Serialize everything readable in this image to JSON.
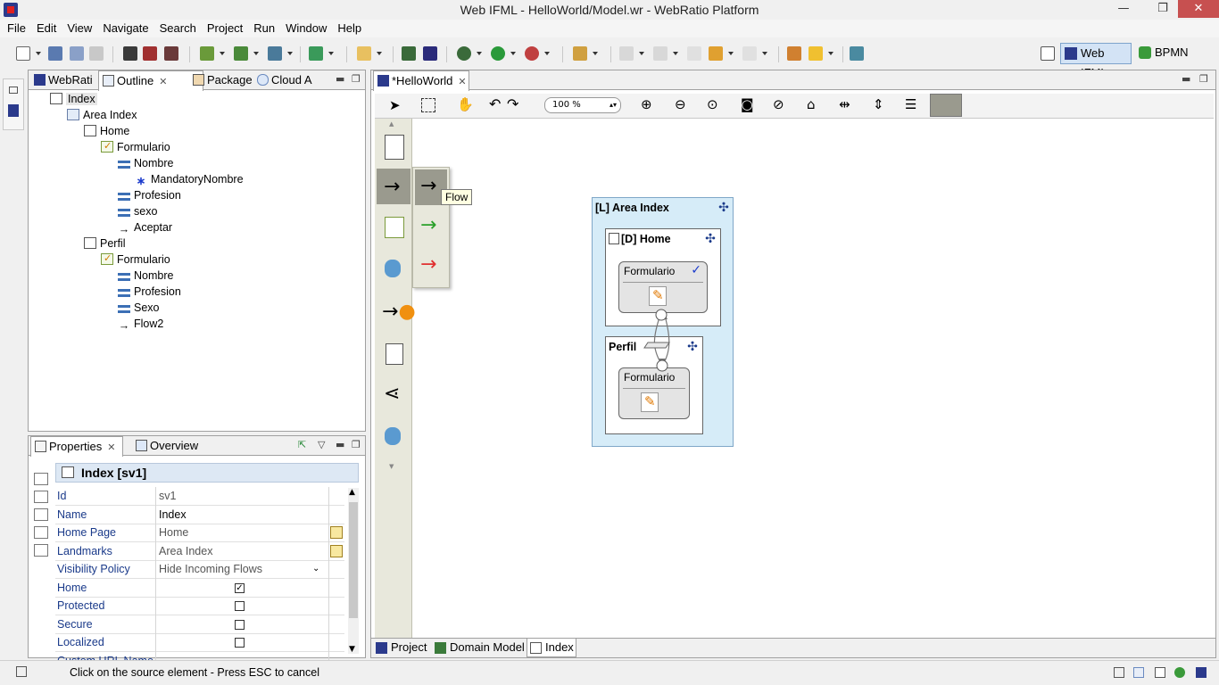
{
  "window": {
    "title": "Web IFML - HelloWorld/Model.wr - WebRatio Platform",
    "min": "—",
    "max": "❐",
    "close": "✕"
  },
  "menu": [
    "File",
    "Edit",
    "View",
    "Navigate",
    "Search",
    "Project",
    "Run",
    "Window",
    "Help"
  ],
  "perspectives": {
    "web_ifml": "Web IFML",
    "bpmn": "BPMN"
  },
  "left_tabs": {
    "webratio": "WebRati",
    "outline": "Outline",
    "package": "Package",
    "cloud": "Cloud A"
  },
  "tree": [
    {
      "label": "Index",
      "icon": "page-icon",
      "depth": 0
    },
    {
      "label": "Area Index",
      "icon": "area-icon",
      "depth": 1
    },
    {
      "label": "Home",
      "icon": "page-icon",
      "depth": 2
    },
    {
      "label": "Formulario",
      "icon": "form-icon",
      "depth": 3
    },
    {
      "label": "Nombre",
      "icon": "field-icon",
      "depth": 4
    },
    {
      "label": "MandatoryNombre",
      "icon": "mandatory-icon",
      "depth": 5
    },
    {
      "label": "Profesion",
      "icon": "field-icon",
      "depth": 4
    },
    {
      "label": "sexo",
      "icon": "field-icon",
      "depth": 4
    },
    {
      "label": "Aceptar",
      "icon": "flow-arrow-icon",
      "depth": 4
    },
    {
      "label": "Perfil",
      "icon": "page-icon",
      "depth": 2
    },
    {
      "label": "Formulario",
      "icon": "form-icon",
      "depth": 3
    },
    {
      "label": "Nombre",
      "icon": "field-icon",
      "depth": 4
    },
    {
      "label": "Profesion",
      "icon": "field-icon",
      "depth": 4
    },
    {
      "label": "Sexo",
      "icon": "field-icon",
      "depth": 4
    },
    {
      "label": "Flow2",
      "icon": "flow-arrow-icon",
      "depth": 4
    }
  ],
  "props_tabs": {
    "properties": "Properties",
    "overview": "Overview"
  },
  "properties": {
    "title": "Index [sv1]",
    "rows": [
      {
        "key": "Id",
        "value": "sv1"
      },
      {
        "key": "Name",
        "value": "Index"
      },
      {
        "key": "Home Page",
        "value": "Home"
      },
      {
        "key": "Landmarks",
        "value": "Area Index"
      },
      {
        "key": "Visibility Policy",
        "value": "Hide Incoming Flows"
      },
      {
        "key": "Home",
        "value": "",
        "checked": true
      },
      {
        "key": "Protected",
        "value": "",
        "checked": false
      },
      {
        "key": "Secure",
        "value": "",
        "checked": false
      },
      {
        "key": "Localized",
        "value": "",
        "checked": false
      },
      {
        "key": "Custom URL Name",
        "value": ""
      }
    ]
  },
  "editor": {
    "tab": "*HelloWorld",
    "zoom": "100 %",
    "tooltip": "Flow",
    "bottom_tabs": [
      "Project",
      "Domain Model",
      "Index"
    ]
  },
  "diagram": {
    "area_label": "[L] Area Index",
    "home_label": "[D] Home",
    "perfil_label": "Perfil",
    "form1_label": "Formulario",
    "form2_label": "Formulario"
  },
  "status": {
    "message": "Click on the source element - Press ESC to cancel"
  },
  "colors": {
    "area_fill": "#d6ecf8",
    "selected_perspective": "#d3e3f5",
    "close_button": "#c75050"
  }
}
